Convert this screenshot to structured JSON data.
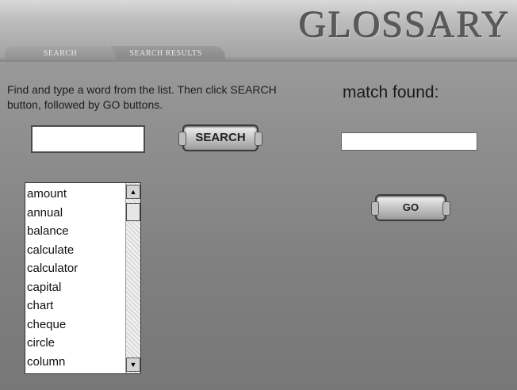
{
  "header": {
    "title": "GLOSSARY",
    "tabs": [
      {
        "label": "SEARCH"
      },
      {
        "label": "SEARCH RESULTS"
      }
    ]
  },
  "search": {
    "instructions": "Find and type a word from the list. Then click SEARCH button, followed by GO buttons.",
    "input_value": "",
    "button_label": "SEARCH"
  },
  "match": {
    "label": "match found:",
    "value": "",
    "go_label": "GO"
  },
  "word_list": {
    "items": [
      "amount",
      "annual",
      "balance",
      "calculate",
      "calculator",
      "capital",
      "chart",
      "cheque",
      "circle",
      "column"
    ],
    "scroll_up_icon": "up-arrow",
    "scroll_down_icon": "down-arrow"
  }
}
